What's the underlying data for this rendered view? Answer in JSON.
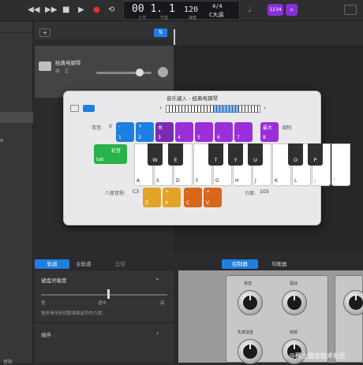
{
  "toolbar": {
    "rewind_icon": "◀◀",
    "forward_icon": "▶▶",
    "stop_icon": "■",
    "play_icon": "▶",
    "record_icon": "●",
    "cycle_icon": "⟲",
    "lcd": {
      "bar_beat": "00 1. 1",
      "bar_label": "小节",
      "beat_label": "节拍",
      "tempo": "120",
      "tempo_label": "速度",
      "signature": "4/4",
      "key": "C大调"
    },
    "tuner_icon": "♩",
    "count_in": "1234",
    "metronome_icon": "⚠"
  },
  "tracks": {
    "add_label": "+",
    "smart_icon": "⇅",
    "track_name": "经典电钢琴"
  },
  "musical_typing": {
    "title": "音乐键入 - 经典电钢琴",
    "pitch_bend_label": "弯音:",
    "pitch_value": "0",
    "modulation_label": "调制",
    "octave_label": "八度音程:",
    "octave_value": "C3",
    "velocity_label": "力度:",
    "velocity_value": "103",
    "sustain_label": "延音",
    "sustain_key": "tab",
    "mod_keys": [
      {
        "top": "-",
        "bottom": "1"
      },
      {
        "top": "+",
        "bottom": "2"
      },
      {
        "top": "关",
        "bottom": "3"
      },
      {
        "top": "",
        "bottom": "4"
      },
      {
        "top": "",
        "bottom": "5"
      },
      {
        "top": "",
        "bottom": "6"
      },
      {
        "top": "",
        "bottom": "7"
      },
      {
        "top": "最大",
        "bottom": "8"
      }
    ],
    "white_keys": [
      "A",
      "S",
      "D",
      "F",
      "G",
      "H",
      "J",
      "K",
      "L",
      ";",
      "'"
    ],
    "black_keys": [
      "W",
      "E",
      "T",
      "Y",
      "U",
      "O",
      "P"
    ],
    "vel_keys": [
      {
        "top": "-",
        "bottom": "Z"
      },
      {
        "top": "+",
        "bottom": "X"
      },
      {
        "top": "-",
        "bottom": "C"
      },
      {
        "top": "+",
        "bottom": "V"
      }
    ]
  },
  "bottom": {
    "tabs": [
      "轨道",
      "主轨道",
      "比较"
    ],
    "sensitivity_label": "键盘灵敏度",
    "low_label": "低",
    "mid_label": "适中",
    "high_label": "高",
    "hint": "拖移滑块来调整弹奏音符的力度。",
    "plugins_label": "插件",
    "right_tabs": [
      "控制器",
      "均衡器"
    ],
    "knob_labels": [
      "拾音",
      "驱动",
      "失真混音",
      "低频"
    ],
    "left_bottom_label": "音轨"
  },
  "watermark": "@稀土掘金技术社区",
  "colors": {
    "blue": "#1f7fe0",
    "purple": "#9a2fd9",
    "green": "#27b24a",
    "orange": "#e2a327"
  }
}
